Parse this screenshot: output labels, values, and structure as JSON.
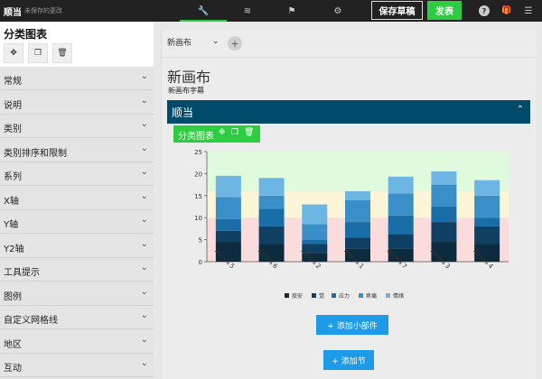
{
  "topbar": {
    "brand": "顺当",
    "unsaved": "未保存的更改",
    "tabs": [
      {
        "icon": "wrench-icon",
        "glyph": "🔧",
        "active": true
      },
      {
        "icon": "database-icon",
        "glyph": "≋",
        "active": false
      },
      {
        "icon": "flag-icon",
        "glyph": "⚑",
        "active": false
      },
      {
        "icon": "gear-icon",
        "glyph": "⚙",
        "active": false
      }
    ],
    "save_draft": "保存草稿",
    "publish": "发表",
    "help_glyph": "?",
    "gift_glyph": "🎁",
    "menu_glyph": "☰"
  },
  "sidebar": {
    "title": "分类图表",
    "tools": [
      {
        "icon": "move-icon",
        "glyph": "✥"
      },
      {
        "icon": "copy-icon",
        "glyph": "❐"
      },
      {
        "icon": "trash-icon",
        "glyph": "🗑"
      }
    ],
    "items": [
      "常规",
      "说明",
      "类别",
      "类别排序和限制",
      "系列",
      "X轴",
      "Y轴",
      "Y2轴",
      "工具提示",
      "图例",
      "自定义网格线",
      "地区",
      "互动"
    ]
  },
  "main": {
    "doc_name": "新画布",
    "add_glyph": "+",
    "canvas_title": "新画布",
    "canvas_subtitle": "新画布字幕",
    "section_title": "顺当",
    "widget_label": "分类图表",
    "add_widget": "+ 添加小部件",
    "add_section": "+ 添加节"
  },
  "colors": {
    "topbar": "#222222",
    "accent_green": "#2ecc40",
    "section_bar": "#004b6b",
    "button_blue": "#1e9be8",
    "band_green": "#dffadc",
    "band_yellow": "#fdf5d8",
    "band_red": "#fbdcdc"
  },
  "chart_data": {
    "type": "bar",
    "stacked": true,
    "categories": [
      "About 5",
      "About 6",
      "About 2",
      "About 1",
      "About 7",
      "About 3",
      "About 4"
    ],
    "series": [
      {
        "name": "痰安",
        "color": "#0d2b3e",
        "values": [
          4.5,
          4.0,
          2.0,
          3.0,
          3.0,
          4.5,
          4.0
        ]
      },
      {
        "name": "觉",
        "color": "#0f3f63",
        "values": [
          2.5,
          4.0,
          2.0,
          2.5,
          3.3,
          4.5,
          4.0
        ]
      },
      {
        "name": "应力",
        "color": "#1a6ea8",
        "values": [
          2.7,
          4.0,
          1.0,
          3.5,
          4.2,
          3.5,
          2.0
        ]
      },
      {
        "name": "疼痛",
        "color": "#3a8fc8",
        "values": [
          5.0,
          3.0,
          3.5,
          5.0,
          5.0,
          5.0,
          5.0
        ]
      },
      {
        "name": "情绪",
        "color": "#6db6e3",
        "values": [
          4.8,
          4.0,
          4.5,
          2.0,
          3.8,
          3.0,
          3.5
        ]
      }
    ],
    "ylim": [
      0,
      25
    ],
    "yticks": [
      0,
      5,
      10,
      15,
      20,
      25
    ],
    "bands": [
      {
        "from": 0,
        "to": 10,
        "color": "#fbdcdc"
      },
      {
        "from": 10,
        "to": 16,
        "color": "#fdf5d8"
      },
      {
        "from": 16,
        "to": 25,
        "color": "#dffadc"
      }
    ],
    "legend": "bottom",
    "grid": false
  }
}
